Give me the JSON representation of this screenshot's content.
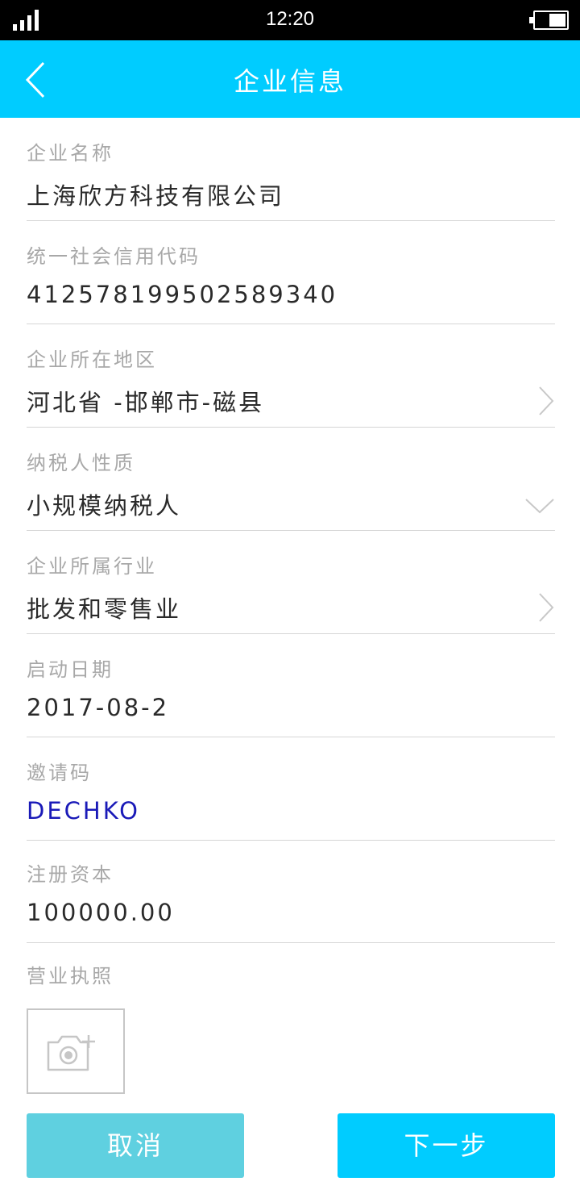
{
  "status_bar": {
    "time": "12:20"
  },
  "header": {
    "title": "企业信息",
    "back_icon": "chevron-left-icon"
  },
  "form": {
    "company_name": {
      "label": "企业名称",
      "value": "上海欣方科技有限公司"
    },
    "credit_code": {
      "label": "统一社会信用代码",
      "value": "412578199502589340"
    },
    "region": {
      "label": "企业所在地区",
      "value": "河北省 -邯郸市-磁县"
    },
    "taxpayer_type": {
      "label": "纳税人性质",
      "value": "小规模纳税人"
    },
    "industry": {
      "label": "企业所属行业",
      "value": "批发和零售业"
    },
    "start_date": {
      "label": "启动日期",
      "value": "2017-08-2"
    },
    "invite_code": {
      "label": "邀请码",
      "value": "DECHKO"
    },
    "registered_capital": {
      "label": "注册资本",
      "value": "100000.00"
    },
    "business_license": {
      "label": "营业执照",
      "upload_icon": "camera-plus-icon"
    }
  },
  "buttons": {
    "cancel_label": "取消",
    "next_label": "下一步"
  },
  "colors": {
    "primary": "#00ccff",
    "cancel_button": "#5fd0e0",
    "invite_code_text": "#1a1ab8",
    "label_text": "#a8a8a8",
    "value_text": "#2a2a2a"
  }
}
